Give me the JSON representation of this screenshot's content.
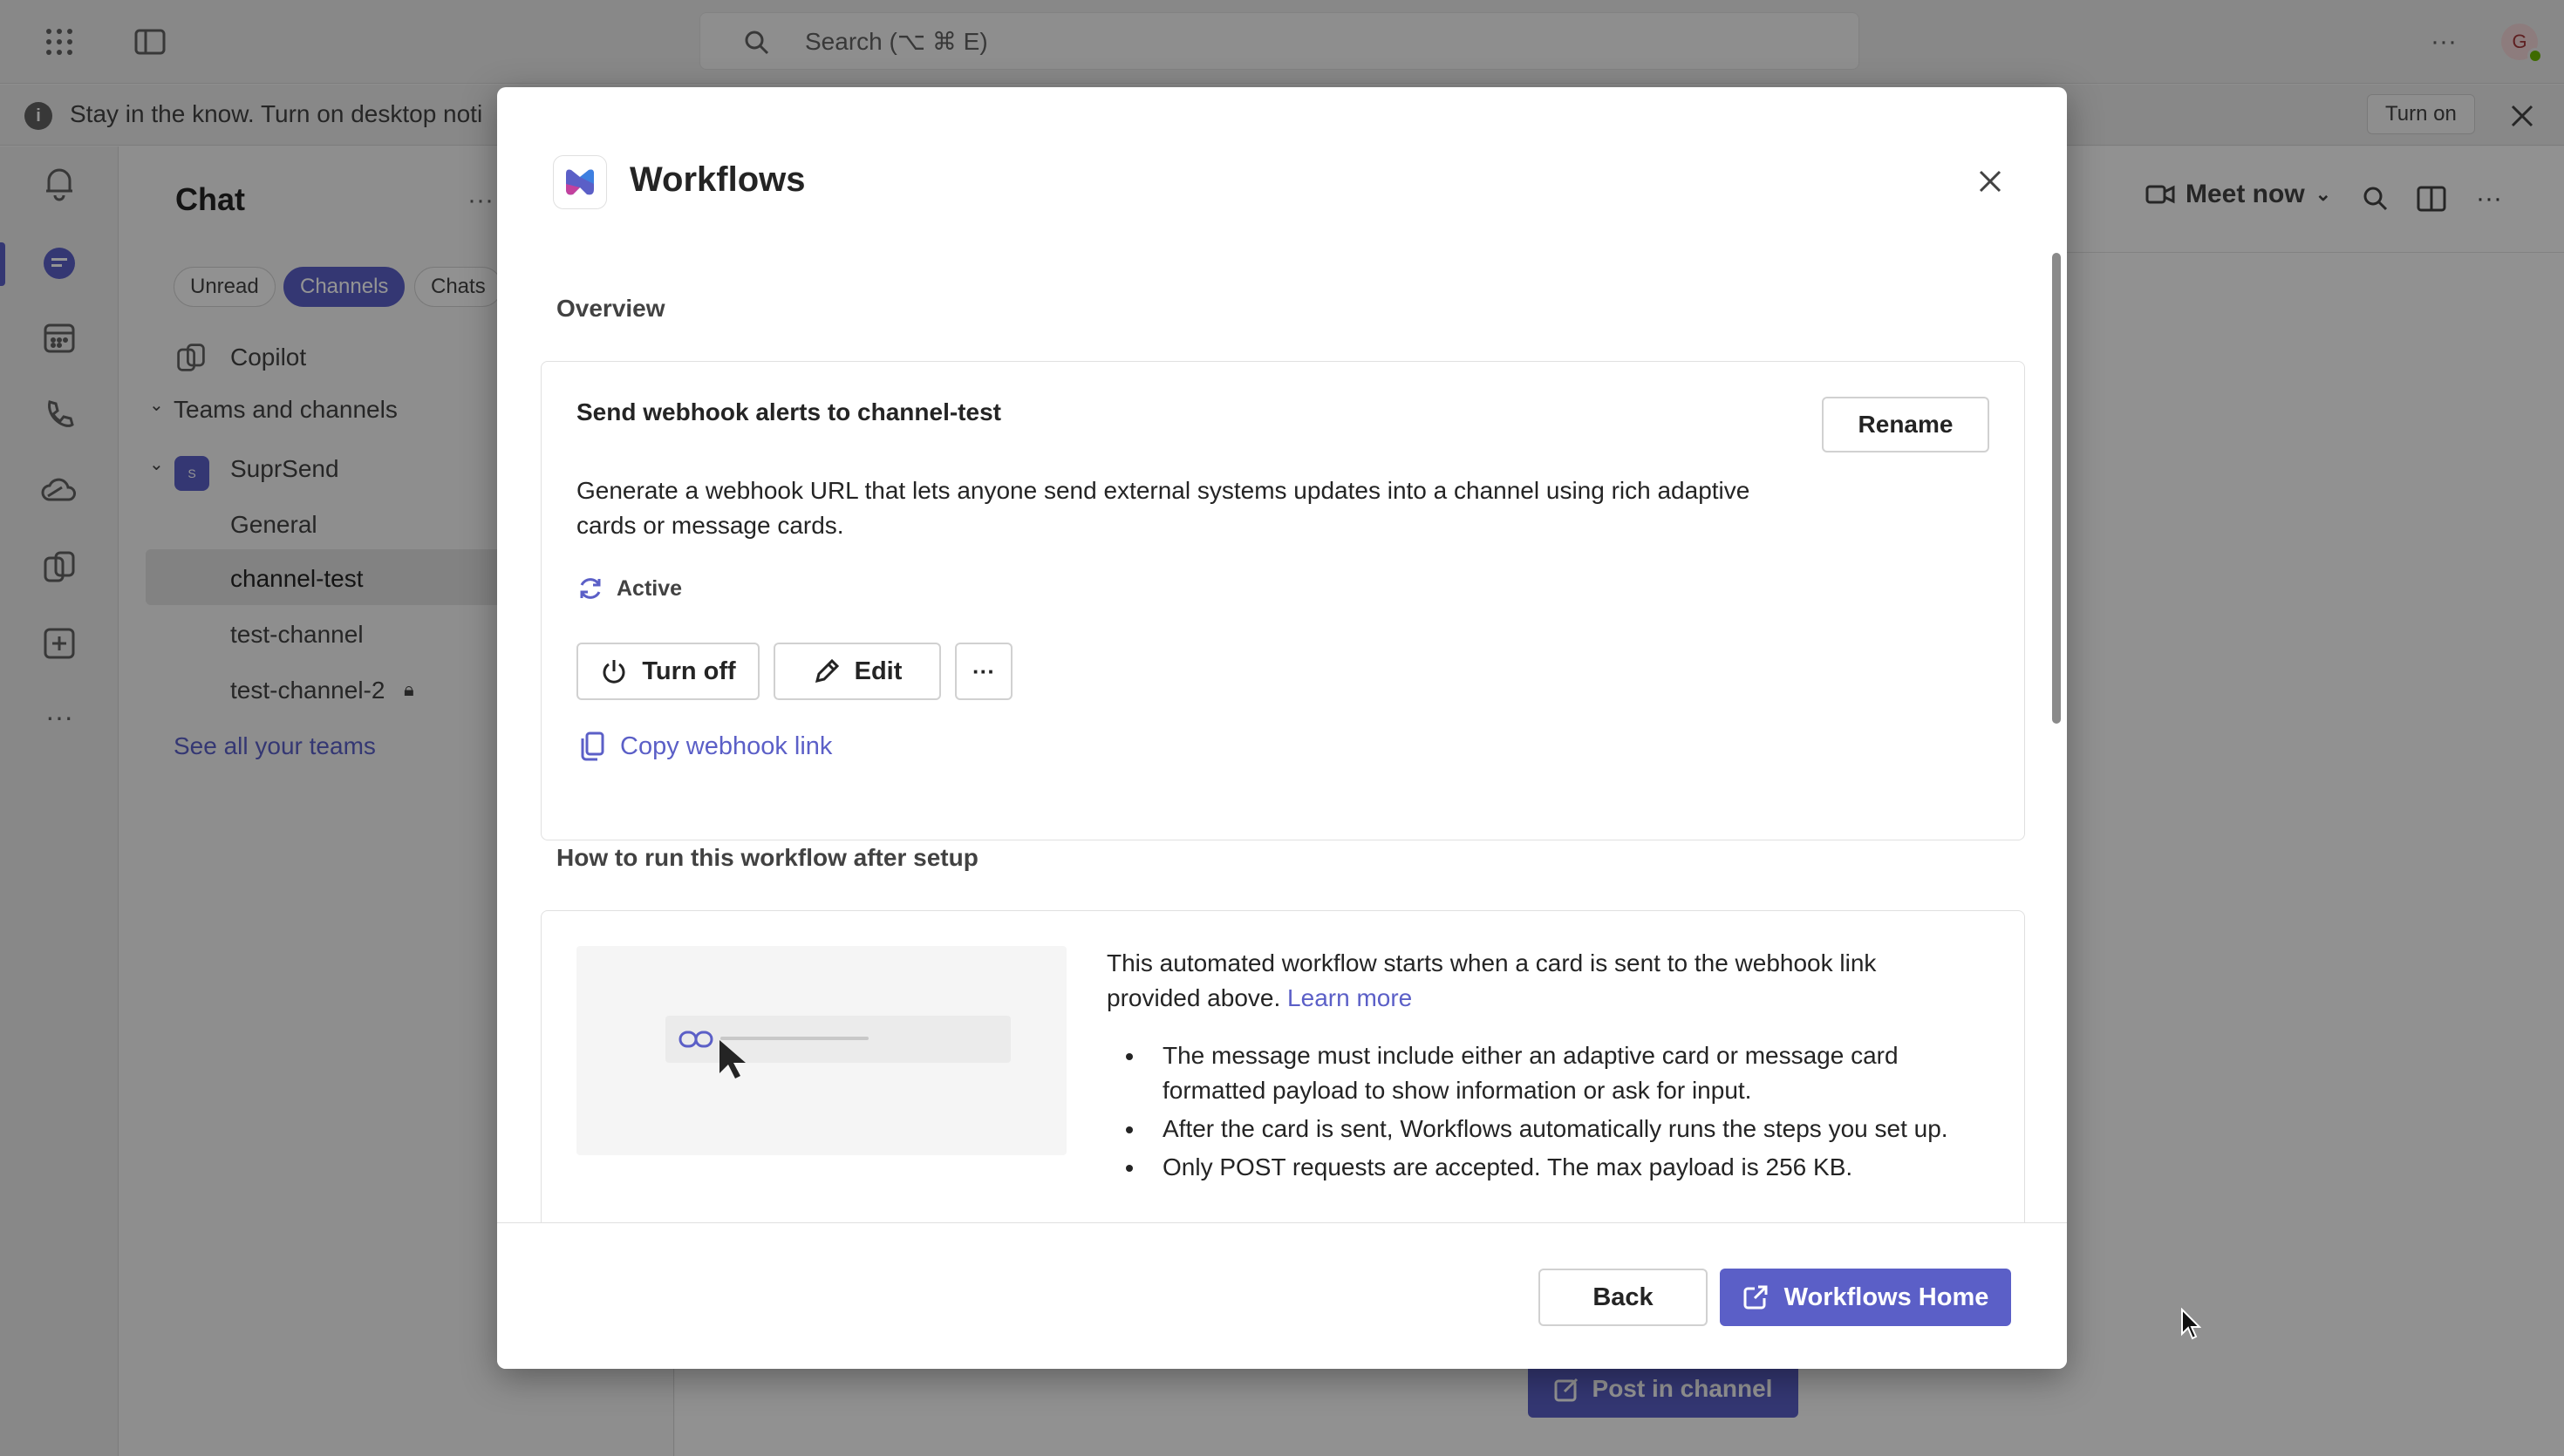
{
  "topbar": {
    "search_placeholder": "Search (⌥ ⌘ E)",
    "avatar_initial": "G"
  },
  "banner": {
    "text": "Stay in the know. Turn on desktop noti",
    "turn_on_label": "Turn on"
  },
  "chat_pane": {
    "title": "Chat",
    "filters": [
      "Unread",
      "Channels",
      "Chats"
    ],
    "copilot_label": "Copilot",
    "teams_header": "Teams and channels",
    "team_name": "SuprSend",
    "team_initial": "S",
    "channels": [
      "General",
      "channel-test",
      "test-channel",
      "test-channel-2"
    ],
    "see_all": "See all your teams"
  },
  "main": {
    "meet_now_label": "Meet now",
    "post_in_channel_label": "Post in channel"
  },
  "modal": {
    "title": "Workflows",
    "overview_heading": "Overview",
    "workflow_card": {
      "title": "Send webhook alerts to channel-test",
      "rename_label": "Rename",
      "description": "Generate a webhook URL that lets anyone send external systems updates into a channel using rich adaptive cards or message cards.",
      "status": "Active",
      "turn_off_label": "Turn off",
      "edit_label": "Edit",
      "more_label": "···",
      "copy_link_label": "Copy webhook link"
    },
    "how_to_heading": "How to run this workflow after setup",
    "how_to_card": {
      "intro": "This automated workflow starts when a card is sent to the webhook link provided above.",
      "learn_more": "Learn more",
      "bullets": [
        "The message must include either an adaptive card or message card formatted payload to show information or ask for input.",
        "After the card is sent, Workflows automatically runs the steps you set up.",
        "Only POST requests are accepted. The max payload is 256 KB."
      ]
    },
    "footer": {
      "back_label": "Back",
      "workflows_home_label": "Workflows Home"
    }
  },
  "colors": {
    "accent": "#5b5fc7",
    "status_green": "#6bb700"
  }
}
